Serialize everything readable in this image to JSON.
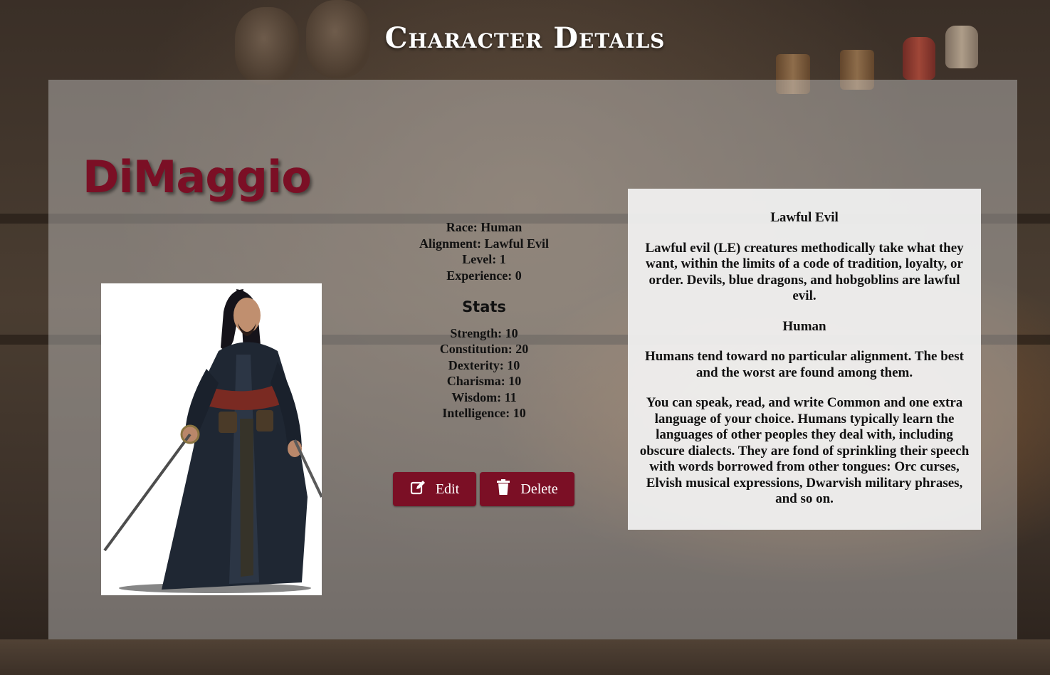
{
  "page": {
    "title": "Character Details"
  },
  "character": {
    "name": "DiMaggio",
    "portrait_alt": "Character portrait",
    "details": {
      "race": "Race: Human",
      "alignment": "Alignment: Lawful Evil",
      "level": "Level: 1",
      "experience": "Experience: 0"
    },
    "stats_heading": "Stats",
    "stats": [
      "Strength: 10",
      "Constitution: 20",
      "Dexterity: 10",
      "Charisma: 10",
      "Wisdom: 11",
      "Intelligence: 10"
    ]
  },
  "actions": {
    "edit_label": "Edit",
    "delete_label": "Delete",
    "edit_icon": "edit-icon",
    "delete_icon": "trash-icon"
  },
  "info": {
    "alignment_title": "Lawful Evil",
    "alignment_desc": "Lawful evil (LE) creatures methodically take what they want, within the limits of a code of tradition, loyalty, or order. Devils, blue dragons, and hobgoblins are lawful evil.",
    "race_title": "Human",
    "race_desc": "Humans tend toward no particular alignment. The best and the worst are found among them.",
    "language_desc": "You can speak, read, and write Common and one extra language of your choice. Humans typically learn the languages of other peoples they deal with, including obscure dialects. They are fond of sprinkling their speech with words borrowed from other tongues: Orc curses, Elvish musical expressions, Dwarvish military phrases, and so on."
  },
  "colors": {
    "accent": "#7b0f25",
    "panel": "#d2d2d2",
    "card": "#f2f2f2"
  }
}
